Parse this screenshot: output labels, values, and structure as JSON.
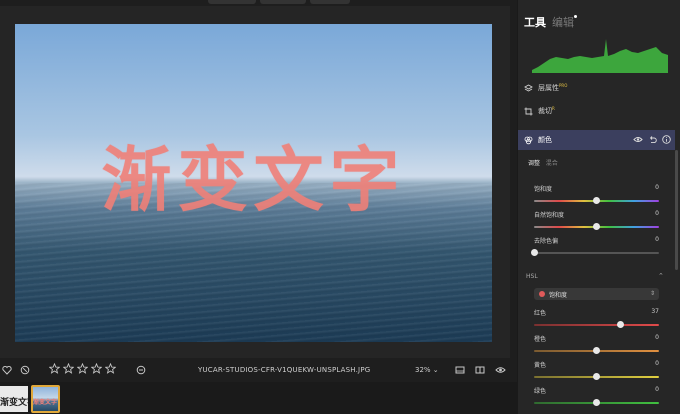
{
  "canvas": {
    "overlay_text": "渐变文字"
  },
  "bottom_bar": {
    "filename": "YUCAR-STUDIOS-CFR-V1QUEKW-UNSPLASH.JPG",
    "zoom": "32%",
    "star_count": 5
  },
  "filmstrip": {
    "thumb1_text": "渐变文字",
    "thumb2_text": "渐变文字"
  },
  "panel": {
    "tab_tools": "工具",
    "tab_edit": "编辑",
    "layer_props": "层属性",
    "layer_props_badge": "PRO",
    "crop": "裁切",
    "crop_badge": "R",
    "color": "颜色",
    "subtab_adjust": "调整",
    "subtab_mix": "混合",
    "sliders": [
      {
        "label": "饱和度",
        "value": "0",
        "position": 0.5
      },
      {
        "label": "自然饱和度",
        "value": "0",
        "position": 0.5
      },
      {
        "label": "去除色偏",
        "value": "0",
        "position": 0.0
      }
    ],
    "hsl_label": "HSL",
    "hsl_channel": "饱和度",
    "hsl_sliders": [
      {
        "label": "红色",
        "value": "37",
        "position": 0.69
      },
      {
        "label": "橙色",
        "value": "0",
        "position": 0.5
      },
      {
        "label": "黄色",
        "value": "0",
        "position": 0.5
      },
      {
        "label": "绿色",
        "value": "0",
        "position": 0.5
      }
    ]
  },
  "colors": {
    "accent_header": "#3b3f5e",
    "histogram_green": "#3da63d",
    "overlay_text": "#f08078",
    "thumb_selected": "#e0a83a"
  }
}
